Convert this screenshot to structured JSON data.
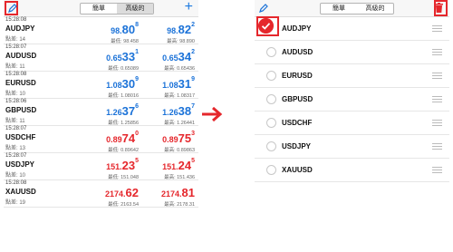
{
  "colors": {
    "accent": "#1b72d8",
    "danger": "#e5272c",
    "highlight": "#e5272c"
  },
  "left": {
    "tabs": [
      "簡單",
      "高級的"
    ],
    "active_tab": "高級的",
    "quotes": [
      {
        "time": "15:28:08",
        "symbol": "AUDJPY",
        "spread_label": "點差: 14",
        "bid_pre": "98.",
        "bid_big": "80",
        "bid_sup": "8",
        "bid_sub": "最低: 98.458",
        "ask_pre": "98.",
        "ask_big": "82",
        "ask_sup": "2",
        "ask_sub": "最高: 98.890",
        "color": "blue"
      },
      {
        "time": "15:28:07",
        "symbol": "AUDUSD",
        "spread_label": "點差: 11",
        "bid_pre": "0.65",
        "bid_big": "33",
        "bid_sup": "1",
        "bid_sub": "最低: 0.65089",
        "ask_pre": "0.65",
        "ask_big": "34",
        "ask_sup": "2",
        "ask_sub": "最高: 0.65436",
        "color": "blue"
      },
      {
        "time": "15:28:08",
        "symbol": "EURUSD",
        "spread_label": "點差: 10",
        "bid_pre": "1.08",
        "bid_big": "30",
        "bid_sup": "9",
        "bid_sub": "最低: 1.08016",
        "ask_pre": "1.08",
        "ask_big": "31",
        "ask_sup": "9",
        "ask_sub": "最高: 1.08317",
        "color": "blue"
      },
      {
        "time": "15:28:06",
        "symbol": "GBPUSD",
        "spread_label": "點差: 11",
        "bid_pre": "1.26",
        "bid_big": "37",
        "bid_sup": "6",
        "bid_sub": "最低: 1.25856",
        "ask_pre": "1.26",
        "ask_big": "38",
        "ask_sup": "7",
        "ask_sub": "最高: 1.26441",
        "color": "blue"
      },
      {
        "time": "15:28:07",
        "symbol": "USDCHF",
        "spread_label": "點差: 13",
        "bid_pre": "0.89",
        "bid_big": "74",
        "bid_sup": "0",
        "bid_sub": "最低: 0.89642",
        "ask_pre": "0.89",
        "ask_big": "75",
        "ask_sup": "3",
        "ask_sub": "最高: 0.89863",
        "color": "red"
      },
      {
        "time": "15:28:07",
        "symbol": "USDJPY",
        "spread_label": "點差: 10",
        "bid_pre": "151.",
        "bid_big": "23",
        "bid_sup": "5",
        "bid_sub": "最低: 151.048",
        "ask_pre": "151.",
        "ask_big": "24",
        "ask_sup": "5",
        "ask_sub": "最高: 151.436",
        "color": "red"
      },
      {
        "time": "15:28:08",
        "symbol": "XAUUSD",
        "spread_label": "點差: 19",
        "bid_pre": "2174.",
        "bid_big": "62",
        "bid_sup": "",
        "bid_sub": "最低: 2163.54",
        "ask_pre": "2174.",
        "ask_big": "81",
        "ask_sup": "",
        "ask_sub": "最高: 2178.31",
        "color": "red"
      }
    ]
  },
  "right": {
    "tabs": [
      "簡單",
      "高級的"
    ],
    "symbols": [
      "AUDJPY",
      "AUDUSD",
      "EURUSD",
      "GBPUSD",
      "USDCHF",
      "USDJPY",
      "XAUUSD"
    ],
    "selected": "AUDJPY"
  },
  "icons": [
    "pencil-icon",
    "plus-icon",
    "trash-icon",
    "checkmark-icon",
    "drag-handle-icon",
    "arrow-right-icon"
  ]
}
